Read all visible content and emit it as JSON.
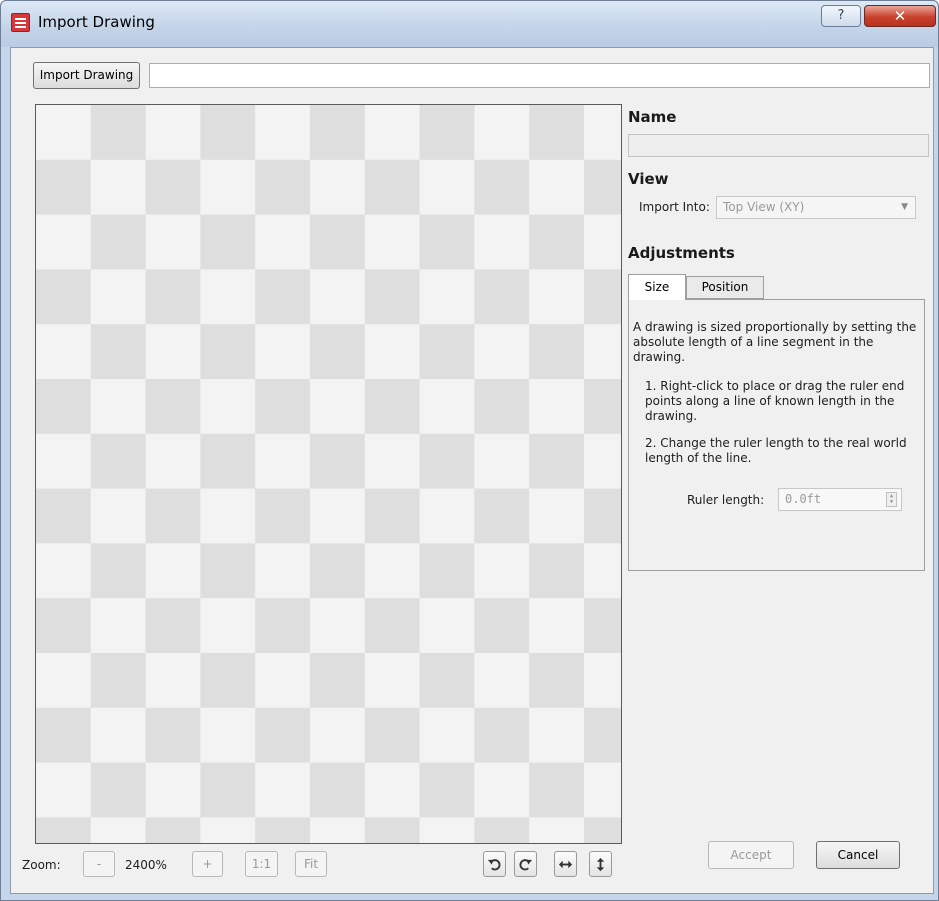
{
  "window": {
    "title": "Import Drawing",
    "help_glyph": "?",
    "close_glyph": "✕"
  },
  "toolbar": {
    "import_button": "Import Drawing",
    "path_value": ""
  },
  "name_section": {
    "heading": "Name",
    "value": ""
  },
  "view_section": {
    "heading": "View",
    "import_into_label": "Import Into:",
    "import_into_value": "Top View (XY)"
  },
  "adjustments": {
    "heading": "Adjustments",
    "tabs": [
      {
        "label": "Size",
        "active": true
      },
      {
        "label": "Position",
        "active": false
      }
    ],
    "intro": "A drawing is sized proportionally by setting the absolute length of a line segment in the drawing.",
    "step1": "1. Right-click to place or drag the ruler end points along a line of known length in the drawing.",
    "step2": "2. Change the ruler length to the real world length of the line.",
    "ruler_label": "Ruler length:",
    "ruler_value": "0.0ft"
  },
  "zoom": {
    "label": "Zoom:",
    "minus": "-",
    "level": "2400%",
    "plus": "+",
    "one_to_one": "1:1",
    "fit": "Fit"
  },
  "transform_icons": [
    "rotate-left-icon",
    "rotate-right-icon",
    "flip-horizontal-icon",
    "flip-vertical-icon"
  ],
  "actions": {
    "accept": "Accept",
    "cancel": "Cancel"
  },
  "colors": {
    "title_bar": "#c3d4e8",
    "close_button": "#c9412c",
    "app_icon": "#d8363b",
    "canvas_light": "#f3f3f3",
    "canvas_dark": "#dedede"
  }
}
